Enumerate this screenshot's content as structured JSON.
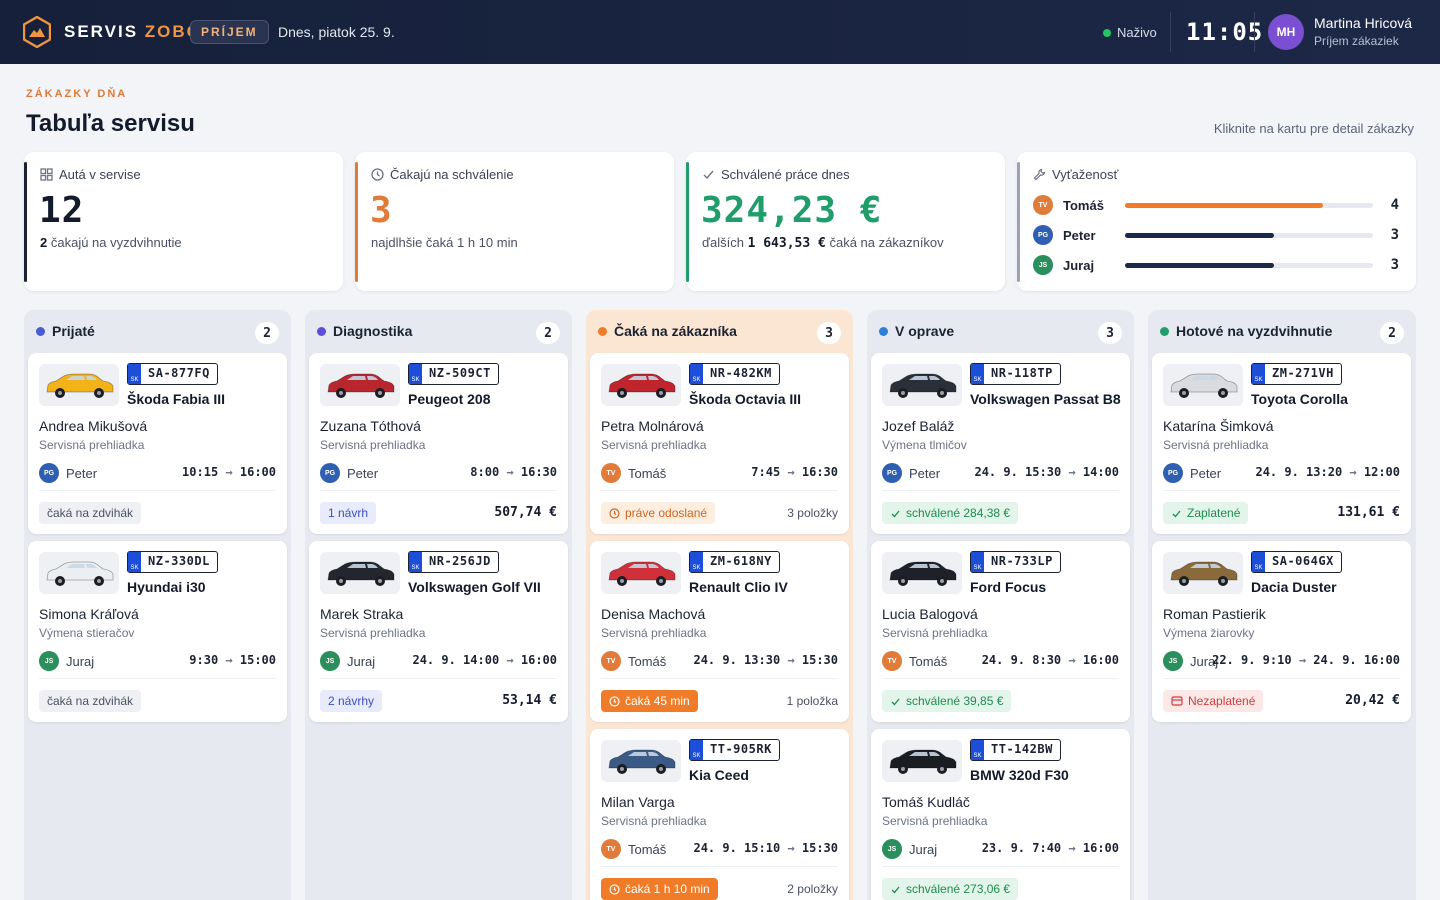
{
  "brand": {
    "name_a": "SERVIS",
    "name_b": "ZOBOR",
    "badge": "PRÍJEM"
  },
  "header": {
    "date": "Dnes, piatok 25. 9.",
    "live": "Naživo",
    "clock": "11:05"
  },
  "user": {
    "initials": "MH",
    "name": "Martina Hricová",
    "role": "Príjem zákaziek"
  },
  "page": {
    "eyebrow": "ZÁKAZKY DŇA",
    "title": "Tabuľa servisu",
    "hint": "Kliknite na kartu pre detail zákazky"
  },
  "kpis": {
    "cars": {
      "label": "Autá v servise",
      "value": "12",
      "sub_bold": "2",
      "sub": "čakajú na vyzdvihnutie",
      "color": "#1b2232"
    },
    "pending": {
      "label": "Čakajú na schválenie",
      "value": "3",
      "sub": "najdlhšie čaká 1 h 10 min",
      "color": "#e07b39"
    },
    "approved": {
      "label": "Schválené práce dnes",
      "value": "324,23 €",
      "sub_a": "ďalších",
      "sub_bold": "1 643,53 €",
      "sub_b": "čaká na zákazníkov",
      "color": "#1f9d6a"
    },
    "load": {
      "label": "Vyťaženosť",
      "rows": [
        {
          "initials": "TV",
          "name": "Tomáš",
          "value": "4",
          "fill": 0.8,
          "color": "#f07c2a",
          "av": "#e07b39"
        },
        {
          "initials": "PG",
          "name": "Peter",
          "value": "3",
          "fill": 0.6,
          "color": "#1b2a4a",
          "av": "#2f5fb0"
        },
        {
          "initials": "JS",
          "name": "Juraj",
          "value": "3",
          "fill": 0.6,
          "color": "#1b2a4a",
          "av": "#2a8f5c"
        }
      ]
    }
  },
  "columns": [
    {
      "title": "Prijaté",
      "count": "2",
      "dot": "#4a5bd4",
      "cards": [
        {
          "plate": "SA-877FQ",
          "model": "Škoda Fabia III",
          "customer": "Andrea Mikušová",
          "service": "Servisná prehliadka",
          "tech": "Peter",
          "tech_initials": "PG",
          "from": "10:15",
          "to": "16:00",
          "chip": "čaká na zdvihák",
          "chip_type": "gray",
          "right": "",
          "car_color": "#f2b218"
        },
        {
          "plate": "NZ-330DL",
          "model": "Hyundai i30",
          "customer": "Simona Kráľová",
          "service": "Výmena stieračov",
          "tech": "Juraj",
          "tech_initials": "JS",
          "from": "9:30",
          "to": "15:00",
          "chip": "čaká na zdvihák",
          "chip_type": "gray",
          "right": "",
          "car_color": "#eceff2"
        }
      ]
    },
    {
      "title": "Diagnostika",
      "count": "2",
      "dot": "#5b4fd8",
      "cards": [
        {
          "plate": "NZ-509CT",
          "model": "Peugeot 208",
          "customer": "Zuzana Tóthová",
          "service": "Servisná prehliadka",
          "tech": "Peter",
          "tech_initials": "PG",
          "from": "8:00",
          "to": "16:30",
          "chip": "1 návrh",
          "chip_type": "blue",
          "right": "507,74 €",
          "car_color": "#b8262e"
        },
        {
          "plate": "NR-256JD",
          "model": "Volkswagen Golf VII",
          "customer": "Marek Straka",
          "service": "Servisná prehliadka",
          "tech": "Juraj",
          "tech_initials": "JS",
          "from": "24. 9. 14:00",
          "to": "16:00",
          "chip": "2 návrhy",
          "chip_type": "blue",
          "right": "53,14 €",
          "car_color": "#23262d"
        }
      ]
    },
    {
      "title": "Čaká na zákazníka",
      "count": "3",
      "dot": "#f07c2a",
      "cards": [
        {
          "plate": "NR-482KM",
          "model": "Škoda Octavia III",
          "customer": "Petra Molnárová",
          "service": "Servisná prehliadka",
          "tech": "Tomáš",
          "tech_initials": "TV",
          "from": "7:45",
          "to": "16:30",
          "chip": "práve odoslané",
          "chip_type": "orange-lt",
          "right_meta": "3 položky",
          "car_color": "#c0242c"
        },
        {
          "plate": "ZM-618NY",
          "model": "Renault Clio IV",
          "customer": "Denisa Machová",
          "service": "Servisná prehliadka",
          "tech": "Tomáš",
          "tech_initials": "TV",
          "from": "24. 9. 13:30",
          "to": "15:30",
          "chip": "čaká 45 min",
          "chip_type": "orange",
          "right_meta": "1 položka",
          "car_color": "#d0303a"
        },
        {
          "plate": "TT-905RK",
          "model": "Kia Ceed",
          "customer": "Milan Varga",
          "service": "Servisná prehliadka",
          "tech": "Tomáš",
          "tech_initials": "TV",
          "from": "24. 9. 15:10",
          "to": "15:30",
          "chip": "čaká 1 h 10 min",
          "chip_type": "orange",
          "right_meta": "2 položky",
          "car_color": "#3b5a86"
        }
      ]
    },
    {
      "title": "V oprave",
      "count": "3",
      "dot": "#2f7fd8",
      "cards": [
        {
          "plate": "NR-118TP",
          "model": "Volkswagen Passat B8",
          "customer": "Jozef Baláž",
          "service": "Výmena tlmičov",
          "tech": "Peter",
          "tech_initials": "PG",
          "from": "24. 9. 15:30",
          "to": "14:00",
          "chip": "schválené 284,38 €",
          "chip_type": "green",
          "right": "",
          "car_color": "#2b3038"
        },
        {
          "plate": "NR-733LP",
          "model": "Ford Focus",
          "customer": "Lucia Balogová",
          "service": "Servisná prehliadka",
          "tech": "Tomáš",
          "tech_initials": "TV",
          "from": "24. 9. 8:30",
          "to": "16:00",
          "chip": "schválené 39,85 €",
          "chip_type": "green",
          "right": "",
          "car_color": "#1e2228"
        },
        {
          "plate": "TT-142BW",
          "model": "BMW 320d F30",
          "customer": "Tomáš Kudláč",
          "service": "Servisná prehliadka",
          "tech": "Juraj",
          "tech_initials": "JS",
          "from": "23. 9. 7:40",
          "to": "16:00",
          "chip": "schválené 273,06 €",
          "chip_type": "green",
          "right": "",
          "car_color": "#1a1d22"
        }
      ]
    },
    {
      "title": "Hotové na vyzdvihnutie",
      "count": "2",
      "dot": "#1f9d6a",
      "cards": [
        {
          "plate": "ZM-271VH",
          "model": "Toyota Corolla",
          "customer": "Katarína Šimková",
          "service": "Servisná prehliadka",
          "tech": "Peter",
          "tech_initials": "PG",
          "from": "24. 9. 13:20",
          "to": "12:00",
          "chip": "Zaplatené",
          "chip_type": "green",
          "right": "131,61 €",
          "car_color": "#d9dbde"
        },
        {
          "plate": "SA-064GX",
          "model": "Dacia Duster",
          "customer": "Roman Pastierik",
          "service": "Výmena žiarovky",
          "tech": "Juraj",
          "tech_initials": "JS",
          "from": "22. 9. 9:10",
          "to": "24. 9. 16:00",
          "chip": "Nezaplatené",
          "chip_type": "red",
          "right": "20,42 €",
          "car_color": "#8a6a3a"
        }
      ]
    }
  ]
}
